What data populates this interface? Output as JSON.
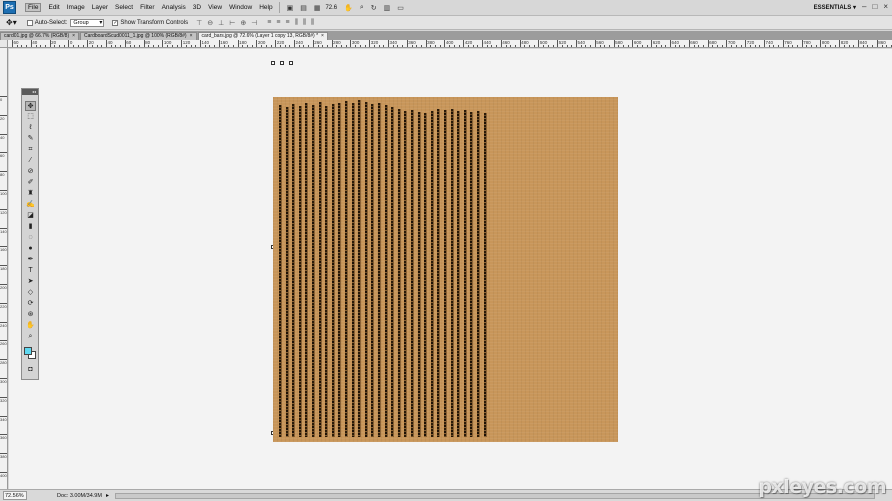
{
  "app": {
    "logo_text": "Ps",
    "menu": [
      "File",
      "Edit",
      "Image",
      "Layer",
      "Select",
      "Filter",
      "Analysis",
      "3D",
      "View",
      "Window",
      "Help"
    ],
    "zoom_readout": "72.6",
    "workspace": "ESSENTIALS ▾"
  },
  "options": {
    "move_tool_icon": "move-tool-icon",
    "auto_select_label": "Auto-Select:",
    "auto_select_value": "Group",
    "transform_label": "Show Transform Controls"
  },
  "tabs": [
    {
      "label": "card01.jpg @ 66.7% (RGB/8)",
      "close": "×",
      "active": false
    },
    {
      "label": "CardboardScud0011_1.jpg @ 100% (RGB/8#)",
      "close": "×",
      "active": false
    },
    {
      "label": "card_bars.jpg @ 72.6% (Layer 1 copy 13, RGB/8#) *",
      "close": "×",
      "active": true
    }
  ],
  "ruler_h_labels": [
    "60",
    "40",
    "20",
    "0",
    "20",
    "40",
    "60",
    "80",
    "100",
    "120",
    "140",
    "160",
    "180",
    "200",
    "220",
    "240",
    "260",
    "280",
    "300",
    "320",
    "340",
    "360",
    "380",
    "400",
    "420",
    "440",
    "460",
    "480",
    "500",
    "520",
    "540",
    "560",
    "580",
    "600",
    "620",
    "640",
    "660",
    "680",
    "700",
    "720",
    "740",
    "760",
    "780",
    "800",
    "820",
    "840",
    "860"
  ],
  "ruler_v_labels": [
    "0",
    "20",
    "40",
    "60",
    "80",
    "100",
    "120",
    "140",
    "160",
    "180",
    "200",
    "220",
    "240",
    "260",
    "280",
    "300",
    "320",
    "340",
    "360",
    "380",
    "400",
    "420",
    "440"
  ],
  "status": {
    "zoom": "72.56%",
    "doc_info": "Doc: 3.00M/34.9M",
    "arrow": "▸"
  },
  "colors": {
    "foreground": "#5fd8f0",
    "background": "#ffffff",
    "document_fill": "#c8965a"
  },
  "watermark": "pxleyes.com"
}
